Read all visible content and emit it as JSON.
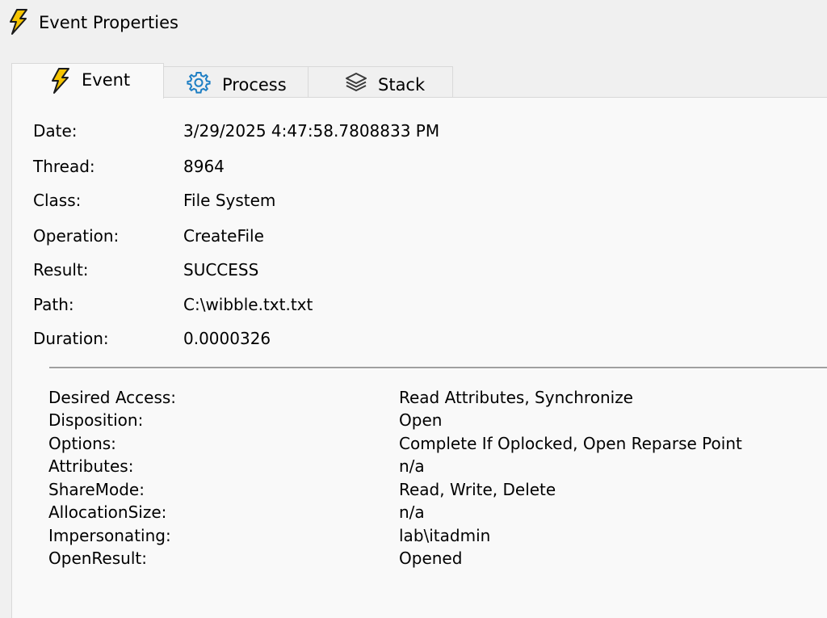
{
  "window": {
    "title": "Event Properties"
  },
  "tabs": [
    {
      "label": "Event",
      "icon": "lightning-icon",
      "active": true
    },
    {
      "label": "Process",
      "icon": "gear-icon",
      "active": false
    },
    {
      "label": "Stack",
      "icon": "layers-icon",
      "active": false
    }
  ],
  "event": {
    "properties": [
      {
        "label": "Date:",
        "value": "3/29/2025 4:47:58.7808833 PM"
      },
      {
        "label": "Thread:",
        "value": "8964"
      },
      {
        "label": "Class:",
        "value": "File System"
      },
      {
        "label": "Operation:",
        "value": "CreateFile"
      },
      {
        "label": "Result:",
        "value": "SUCCESS"
      },
      {
        "label": "Path:",
        "value": "C:\\wibble.txt.txt"
      },
      {
        "label": "Duration:",
        "value": "0.0000326"
      }
    ],
    "details": [
      {
        "label": "Desired Access:",
        "value": "Read Attributes, Synchronize"
      },
      {
        "label": "Disposition:",
        "value": "Open"
      },
      {
        "label": "Options:",
        "value": "Complete If Oplocked, Open Reparse Point"
      },
      {
        "label": "Attributes:",
        "value": "n/a"
      },
      {
        "label": "ShareMode:",
        "value": "Read, Write, Delete"
      },
      {
        "label": "AllocationSize:",
        "value": "n/a"
      },
      {
        "label": "Impersonating:",
        "value": "lab\\itadmin"
      },
      {
        "label": "OpenResult:",
        "value": "Opened"
      }
    ]
  },
  "colors": {
    "lightning_fill": "#f5c400",
    "lightning_stroke": "#1a1a1a",
    "gear_color": "#1e7fc4",
    "layers_color": "#3a3a3a",
    "panel_bg": "#f9f9f9",
    "window_bg": "#f0f0f0"
  }
}
